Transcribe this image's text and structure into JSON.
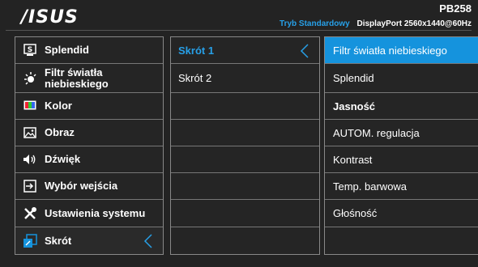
{
  "header": {
    "logo": "/ISUS",
    "model": "PB258",
    "mode": "Tryb Standardowy",
    "port": "DisplayPort  2560x1440@60Hz"
  },
  "menu": [
    {
      "label": "Splendid",
      "icon": "splendid-icon"
    },
    {
      "label": "Filtr światła niebieskiego",
      "icon": "bluelight-icon"
    },
    {
      "label": "Kolor",
      "icon": "color-icon"
    },
    {
      "label": "Obraz",
      "icon": "image-icon"
    },
    {
      "label": "Dźwięk",
      "icon": "speaker-icon"
    },
    {
      "label": "Wybór wejścia",
      "icon": "input-icon"
    },
    {
      "label": "Ustawienia systemu",
      "icon": "tools-icon"
    },
    {
      "label": "Skrót",
      "icon": "shortcut-icon"
    }
  ],
  "shortcuts": {
    "items": [
      "Skrót 1",
      "Skrót 2",
      "",
      "",
      "",
      "",
      "",
      ""
    ],
    "active_index": 0
  },
  "options": {
    "items": [
      "Filtr światła niebieskiego",
      "Splendid",
      "Jasność",
      "AUTOM. regulacja",
      "Kontrast",
      "Temp. barwowa",
      "Głośność",
      ""
    ],
    "highlight_index": 0,
    "bold_index": 2
  },
  "colors": {
    "accent": "#1593dd",
    "active_text": "#27a0e8",
    "background": "#232323"
  }
}
